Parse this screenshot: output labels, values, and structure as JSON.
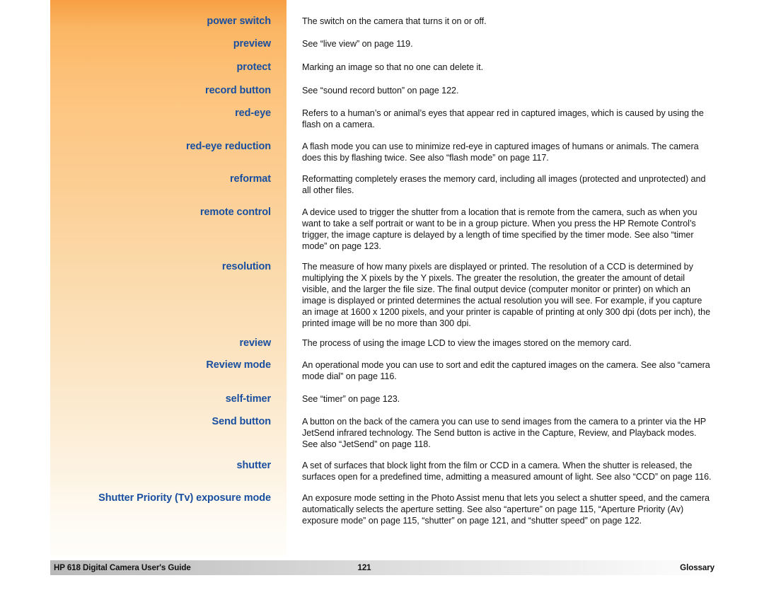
{
  "document": {
    "title": "HP 618 Digital Camera User's Guide",
    "section": "Glossary",
    "page_number": "121",
    "accent_blue": "#1a4fa0",
    "band_top_orange": "#f79f42",
    "band_bottom_orange": "#fffdf9"
  },
  "glossary": {
    "entries": [
      {
        "term": "power switch",
        "definition": "The switch on the camera that turns it on or off."
      },
      {
        "term": "preview",
        "definition": "See “live view” on page 119."
      },
      {
        "term": "protect",
        "definition": "Marking an image so that no one can delete it."
      },
      {
        "term": "record button",
        "definition": "See “sound record button” on page 122."
      },
      {
        "term": "red-eye",
        "definition": "Refers to a human’s or animal’s eyes that appear red in captured images, which is caused by using the flash on a camera."
      },
      {
        "term": "red-eye reduction",
        "definition": "A flash mode you can use to minimize red-eye in captured images of humans or animals. The camera does this by flashing twice. See also “flash mode” on page 117."
      },
      {
        "term": "reformat",
        "definition": "Reformatting completely erases the memory card, including all images (protected and unprotected) and all other files."
      },
      {
        "term": "remote control",
        "definition": "A device used to trigger the shutter from a location that is remote from the camera, such as when you want to take a self portrait or want to be in a group picture. When you press the HP Remote Control’s trigger, the image capture is delayed by a length of time specified by the timer mode. See also “timer mode” on page 123."
      },
      {
        "term": "resolution",
        "definition": "The measure of how many pixels are displayed or printed. The resolution of a CCD is determined by multiplying the X pixels by the Y pixels. The greater the resolution, the greater the amount of detail visible, and the larger the file size. The final output device (computer monitor or printer) on which an image is displayed or printed determines the actual resolution you will see. For example, if you capture an image at 1600 x 1200 pixels, and your printer is capable of printing at only 300 dpi (dots per inch), the printed image will be no more than 300 dpi."
      },
      {
        "term": "review",
        "definition": "The process of using the image LCD to view the images stored on the memory card."
      },
      {
        "term": "Review mode",
        "definition": "An operational mode you can use to sort and edit the captured images on the camera. See also “camera mode dial” on page 116."
      },
      {
        "term": "self-timer",
        "definition": "See “timer” on page 123."
      },
      {
        "term": "Send button",
        "definition": "A button on the back of the camera you can use to send images from the camera to a printer via the HP JetSend infrared technology. The Send button is active in the Capture, Review, and Playback modes. See also “JetSend” on page 118."
      },
      {
        "term": "shutter",
        "definition": "A set of surfaces that block light from the film or CCD in a camera. When the shutter is released, the surfaces open for a predefined time, admitting a measured amount of light. See also “CCD” on page 116."
      },
      {
        "term": "Shutter Priority (Tv) exposure mode",
        "definition": "An exposure mode setting in the Photo Assist menu that lets you select a shutter speed, and the camera automatically selects the aperture setting. See also “aperture” on page 115, “Aperture Priority (Av) exposure mode” on page 115, “shutter” on page 121, and “shutter speed” on page 122."
      }
    ],
    "layout": {
      "tops": [
        22,
        54,
        87,
        120,
        152,
        199,
        245,
        292,
        369,
        477,
        508,
        556,
        588,
        650,
        696
      ]
    }
  }
}
